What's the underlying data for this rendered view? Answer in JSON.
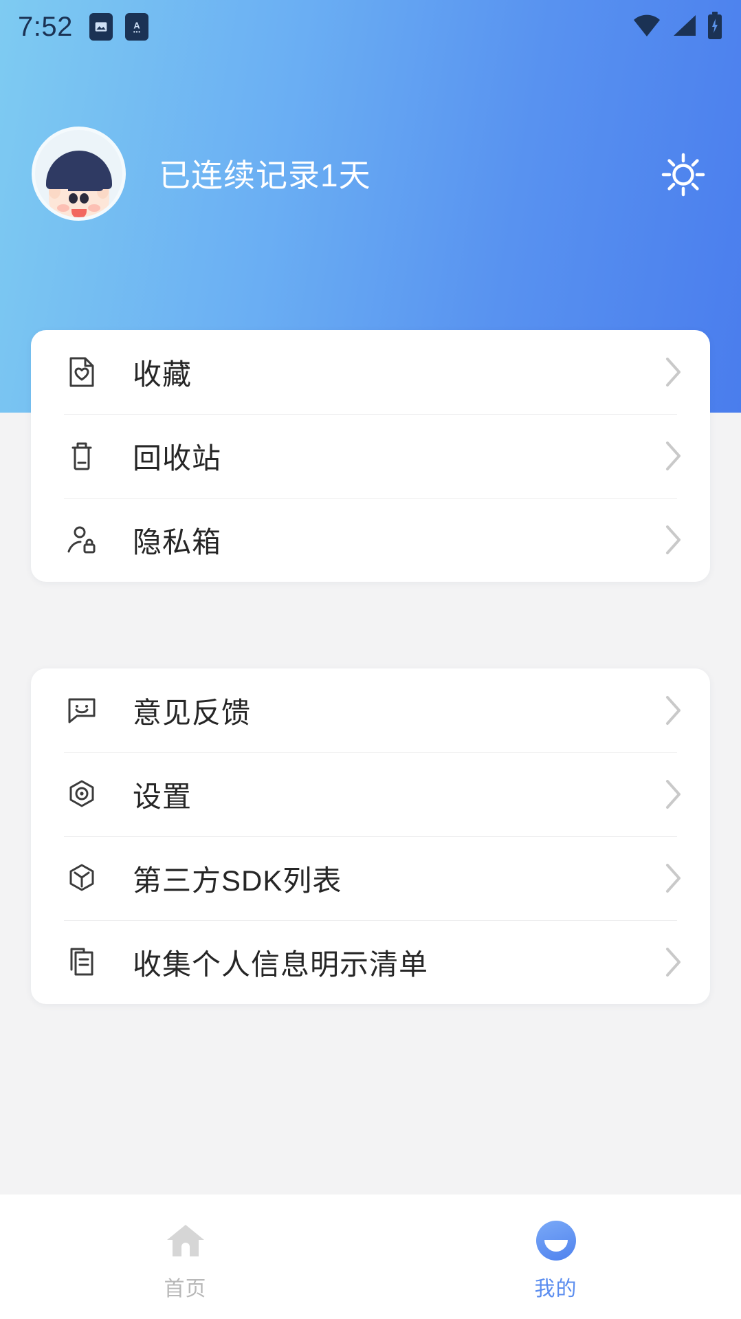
{
  "status_bar": {
    "time": "7:52",
    "left_icons": [
      "gallery-icon",
      "app-a-icon"
    ],
    "right_icons": [
      "wifi-icon",
      "cellular-signal-icon",
      "battery-charging-icon"
    ],
    "icon_color": "#1b3254"
  },
  "header": {
    "greeting": "已连续记录1天",
    "avatar_alt": "用户头像",
    "brightness_icon": "sun-icon",
    "gradient_from": "#7ecbf2",
    "gradient_to": "#4a7ded"
  },
  "cards": [
    {
      "rows": [
        {
          "icon": "document-heart-icon",
          "label": "收藏"
        },
        {
          "icon": "trash-icon",
          "label": "回收站"
        },
        {
          "icon": "person-lock-icon",
          "label": "隐私箱"
        }
      ]
    },
    {
      "rows": [
        {
          "icon": "smiley-chat-icon",
          "label": "意见反馈"
        },
        {
          "icon": "hex-gear-icon",
          "label": "设置"
        },
        {
          "icon": "cube-icon",
          "label": "第三方SDK列表"
        },
        {
          "icon": "document-copy-icon",
          "label": "收集个人信息明示清单"
        }
      ]
    }
  ],
  "bottom_nav": {
    "active": "我的",
    "tabs": [
      {
        "icon": "home-icon",
        "label": "首页",
        "active": false,
        "color": "#d4d4d4"
      },
      {
        "icon": "avatar-circle-icon",
        "label": "我的",
        "active": true,
        "color": "#5b8def"
      }
    ]
  }
}
